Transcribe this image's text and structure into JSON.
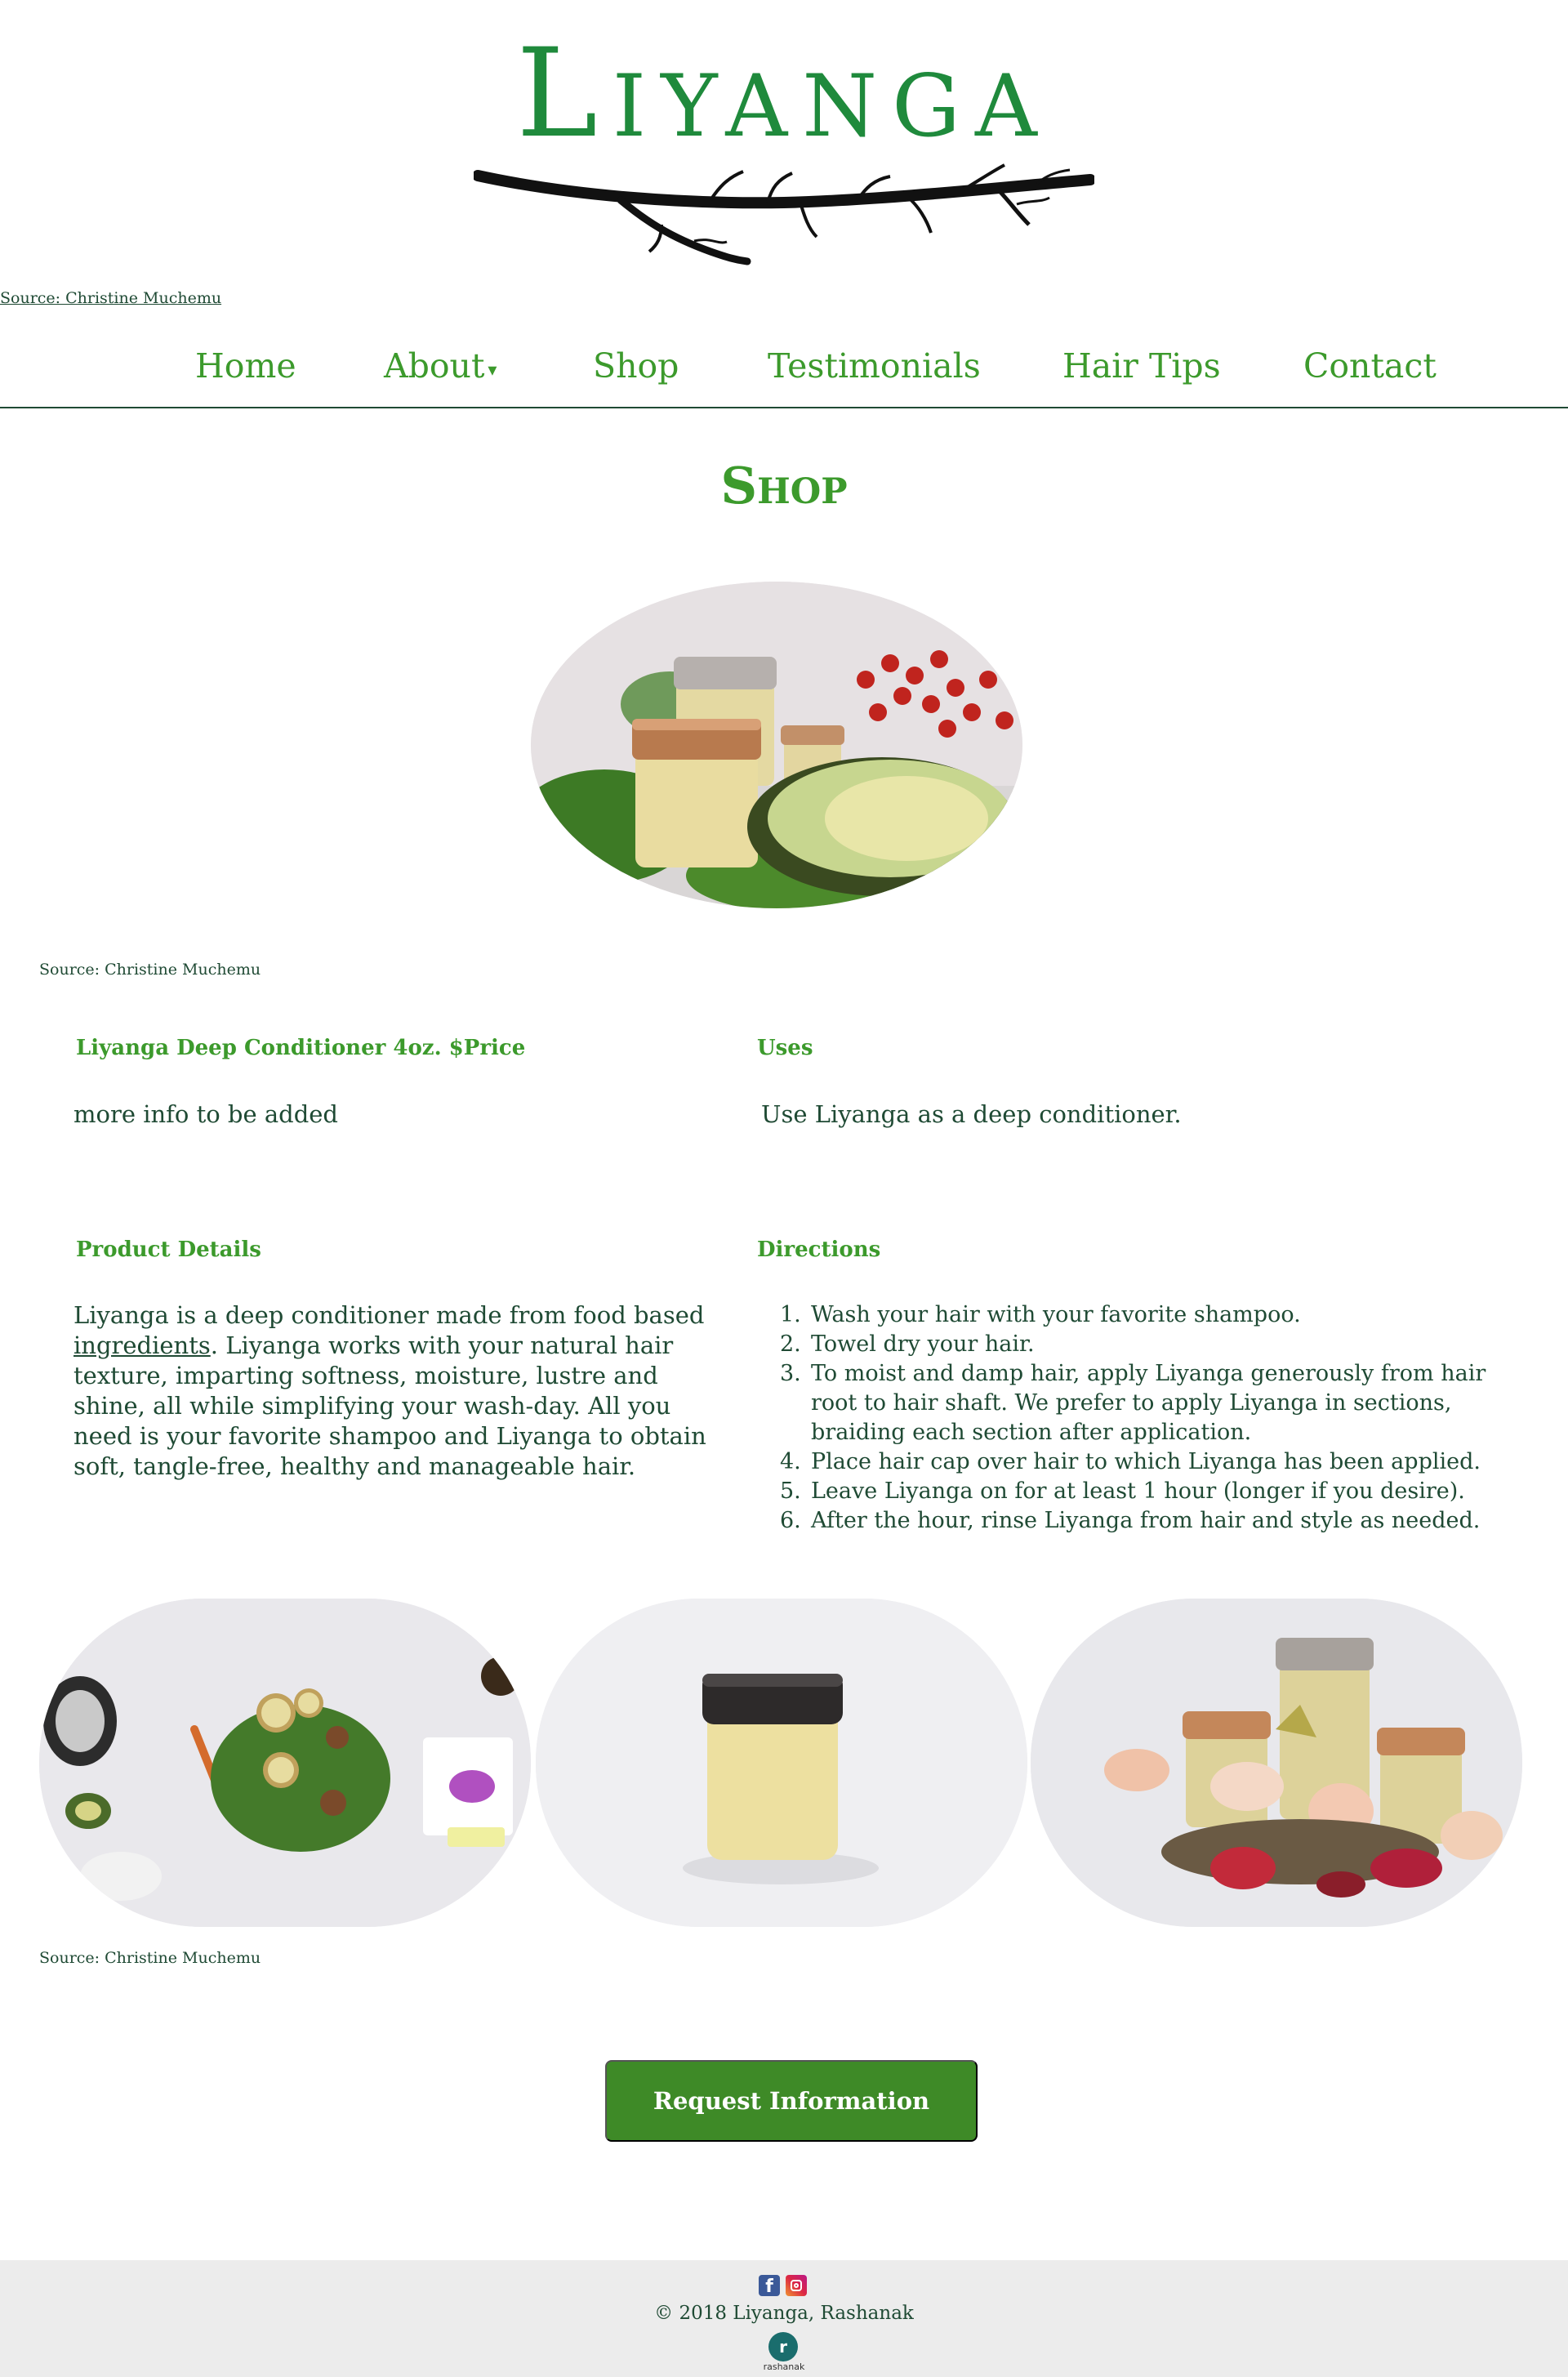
{
  "brand": {
    "logo_text": "Liyanga",
    "logo_source": "Source: Christine Muchemu"
  },
  "nav": {
    "items": [
      {
        "label": "Home"
      },
      {
        "label": "About"
      },
      {
        "label": "Shop"
      },
      {
        "label": "Testimonials"
      },
      {
        "label": "Hair Tips"
      },
      {
        "label": "Contact"
      }
    ],
    "about_caret": "▾"
  },
  "page": {
    "title": "Shop",
    "hero_caption": "Source: Christine Muchemu",
    "gallery_caption": "Source: Christine Muchemu"
  },
  "product": {
    "name_heading": "Liyanga Deep Conditioner 4oz. $Price",
    "name_text": "more info to be added",
    "uses_heading": "Uses",
    "uses_text": "Use Liyanga as a deep conditioner.",
    "details_heading": "Product Details",
    "details_text_before": "Liyanga is a deep conditioner made from food based",
    "details_link": "ingredients",
    "details_text_after": ". Liyanga works with your natural hair texture, imparting softness, moisture, lustre and shine, all while simplifying your wash-day. All you need is your favorite shampoo and Liyanga to obtain soft, tangle-free, healthy and manageable hair.",
    "directions_heading": "Directions",
    "directions": [
      {
        "num": "1.",
        "text": "Wash your hair with your favorite shampoo."
      },
      {
        "num": "2.",
        "text": "Towel dry your hair."
      },
      {
        "num": "3.",
        "text": "To moist and damp hair, apply Liyanga generously from hair root to hair shaft. We prefer to apply Liyanga in sections, braiding each section after application."
      },
      {
        "num": "4.",
        "text": "Place hair cap over hair to which Liyanga has been applied."
      },
      {
        "num": "5.",
        "text": "Leave Liyanga on for at least 1 hour (longer if you desire)."
      },
      {
        "num": "6.",
        "text": "After the hour, rinse Liyanga from hair and style as needed."
      }
    ]
  },
  "cta": {
    "request_label": "Request Information"
  },
  "footer": {
    "facebook_glyph": "f",
    "copyright": "© 2018 Liyanga, Rashanak",
    "badge_glyph": "r",
    "badge_label": "rashanak"
  },
  "colors": {
    "brand_green": "#1f8a3c",
    "nav_green": "#3c9a2c",
    "button_green": "#3e8a27",
    "text_dark": "#1f4a34",
    "footer_bg": "#ececec"
  }
}
